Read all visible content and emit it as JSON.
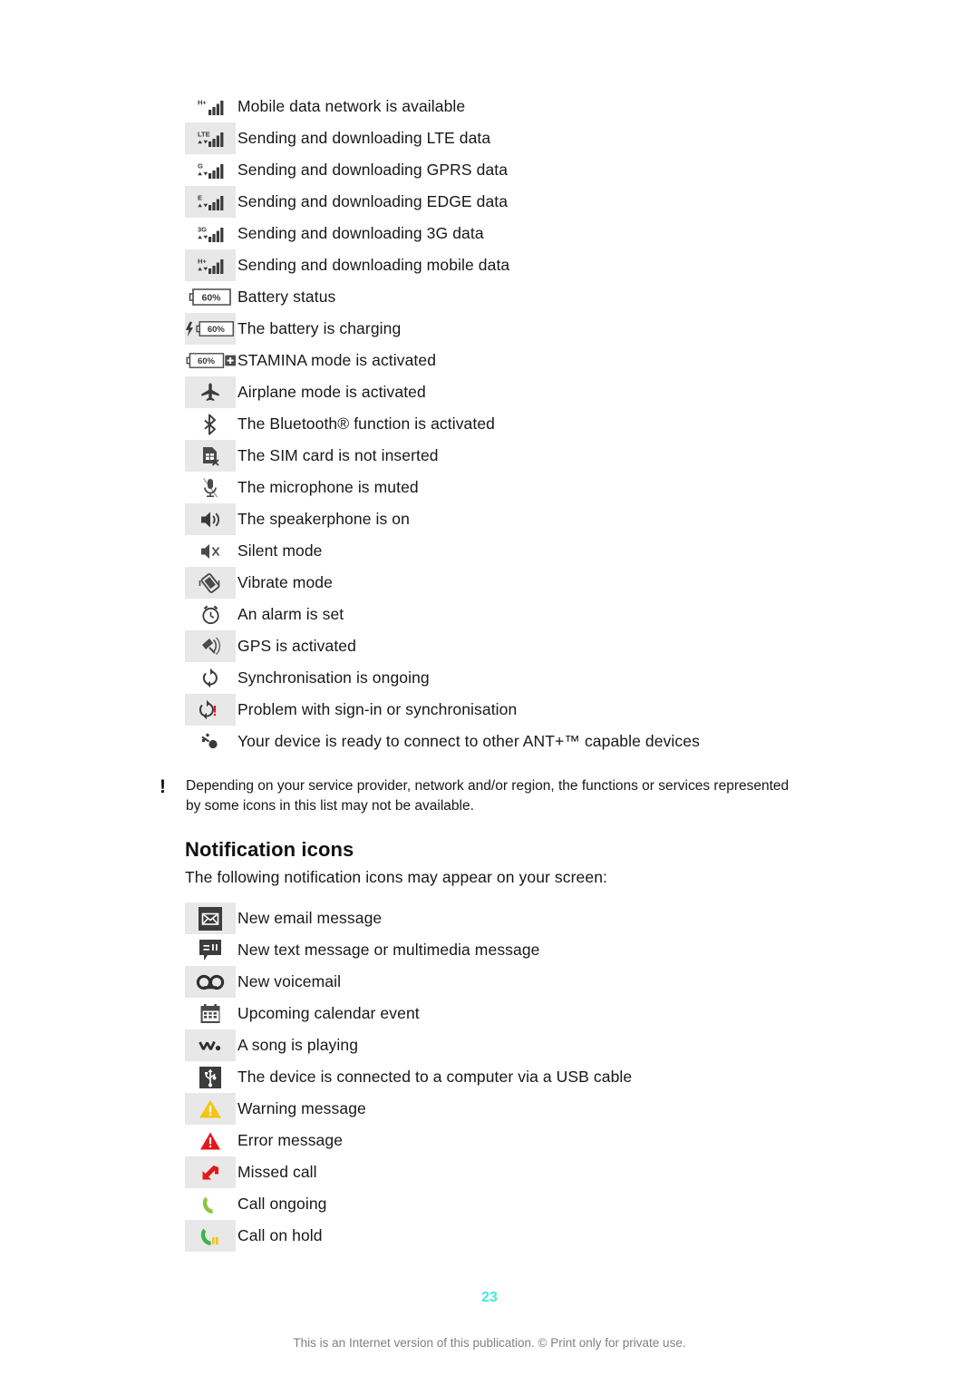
{
  "document": {
    "page_number": "23",
    "footer_note": "This is an Internet version of this publication. © Print only for private use."
  },
  "status_icons": {
    "rows": [
      {
        "icon": "signal-hplus-icon",
        "label": "Mobile data network is available",
        "shaded": false
      },
      {
        "icon": "signal-lte-data-icon",
        "label": "Sending and downloading LTE data",
        "shaded": true
      },
      {
        "icon": "signal-gprs-data-icon",
        "label": "Sending and downloading GPRS data",
        "shaded": false
      },
      {
        "icon": "signal-edge-data-icon",
        "label": "Sending and downloading EDGE data",
        "shaded": true
      },
      {
        "icon": "signal-3g-data-icon",
        "label": "Sending and downloading 3G data",
        "shaded": false
      },
      {
        "icon": "signal-mobile-data-icon",
        "label": "Sending and downloading mobile data",
        "shaded": true
      },
      {
        "icon": "battery-status-icon",
        "label": "Battery status",
        "shaded": false
      },
      {
        "icon": "battery-charging-icon",
        "label": "The battery is charging",
        "shaded": true
      },
      {
        "icon": "stamina-mode-icon",
        "label": "STAMINA mode is activated",
        "shaded": false
      },
      {
        "icon": "airplane-mode-icon",
        "label": "Airplane mode is activated",
        "shaded": true
      },
      {
        "icon": "bluetooth-icon",
        "label": "The Bluetooth® function is activated",
        "shaded": false
      },
      {
        "icon": "sim-card-missing-icon",
        "label": "The SIM card is not inserted",
        "shaded": true
      },
      {
        "icon": "microphone-muted-icon",
        "label": "The microphone is muted",
        "shaded": false
      },
      {
        "icon": "speakerphone-icon",
        "label": "The speakerphone is on",
        "shaded": true
      },
      {
        "icon": "silent-mode-icon",
        "label": "Silent mode",
        "shaded": false
      },
      {
        "icon": "vibrate-mode-icon",
        "label": "Vibrate mode",
        "shaded": true
      },
      {
        "icon": "alarm-clock-icon",
        "label": "An alarm is set",
        "shaded": false
      },
      {
        "icon": "gps-icon",
        "label": "GPS is activated",
        "shaded": true
      },
      {
        "icon": "sync-icon",
        "label": "Synchronisation is ongoing",
        "shaded": false
      },
      {
        "icon": "sync-problem-icon",
        "label": "Problem with sign-in or synchronisation",
        "shaded": true
      },
      {
        "icon": "ant-plus-icon",
        "label": "Your device is ready to connect  to other ANT+™ capable devices",
        "shaded": false
      }
    ]
  },
  "note": {
    "marker": "!",
    "text": "Depending on your service provider, network and/or region, the functions or services represented by some icons in this list may not be available."
  },
  "notification_section": {
    "heading": "Notification icons",
    "intro": "The following notification icons may appear on your screen:",
    "rows": [
      {
        "icon": "new-email-icon",
        "label": "New email message",
        "shaded": true
      },
      {
        "icon": "new-text-message-icon",
        "label": "New text message or multimedia message",
        "shaded": false
      },
      {
        "icon": "new-voicemail-icon",
        "label": "New voicemail",
        "shaded": true
      },
      {
        "icon": "calendar-event-icon",
        "label": "Upcoming calendar event",
        "shaded": false
      },
      {
        "icon": "music-playing-icon",
        "label": "A song is playing",
        "shaded": true
      },
      {
        "icon": "usb-connected-icon",
        "label": "The device is connected to a computer via a USB cable",
        "shaded": false
      },
      {
        "icon": "warning-icon",
        "label": "Warning message",
        "shaded": true
      },
      {
        "icon": "error-icon",
        "label": "Error message",
        "shaded": false
      },
      {
        "icon": "missed-call-icon",
        "label": "Missed call",
        "shaded": true
      },
      {
        "icon": "call-ongoing-icon",
        "label": "Call ongoing",
        "shaded": false
      },
      {
        "icon": "call-on-hold-icon",
        "label": "Call on hold",
        "shaded": true
      }
    ]
  },
  "icon_text": {
    "battery_percent": "60%",
    "lte": "LTE",
    "gprs": "G",
    "edge": "E",
    "three_g": "3G",
    "hplus": "H+",
    "stamina_plus": "+",
    "sync_problem_bang": "!"
  },
  "colors": {
    "page_number": "#41e8e0",
    "warning": "#f5c518",
    "error": "#e3181b",
    "missed_call": "#e3181b",
    "call_green": "#8cc63f",
    "call_hold_green": "#3bb44a",
    "icon_dark": "#3a3a3a",
    "row_shade": "#e8e8e8"
  }
}
